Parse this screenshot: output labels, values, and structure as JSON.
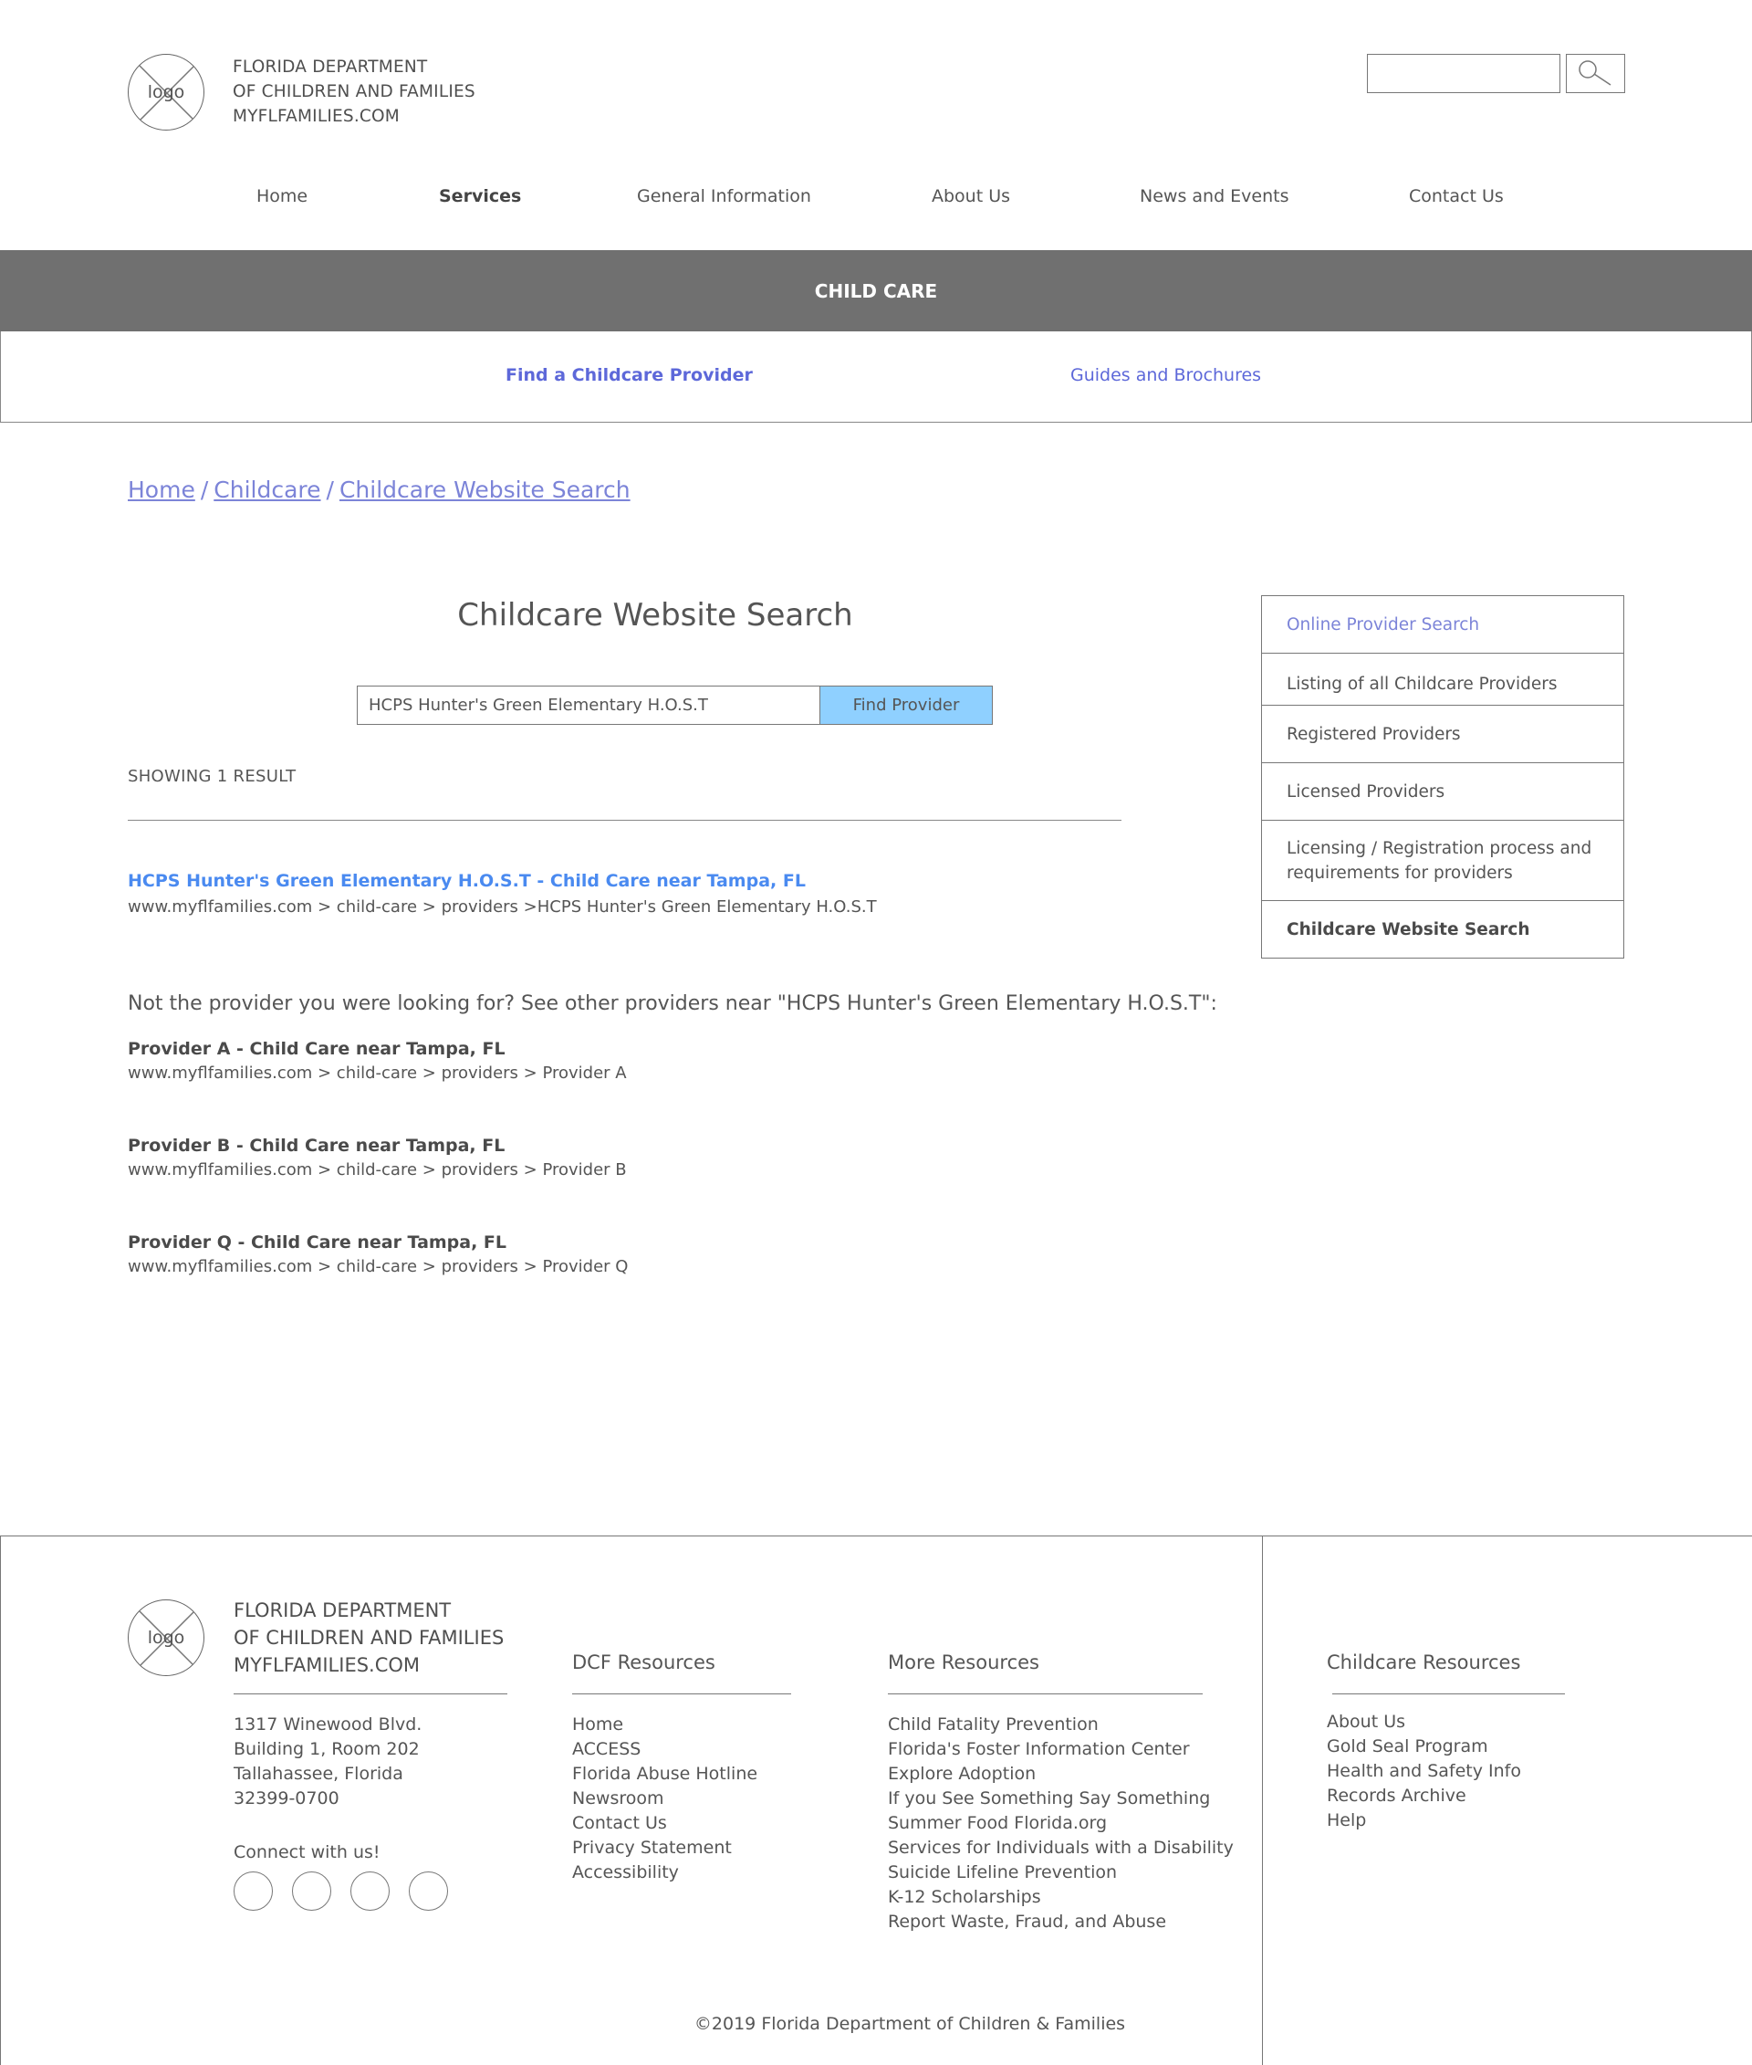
{
  "header": {
    "logo_label": "logo",
    "org_line1": "FLORIDA DEPARTMENT",
    "org_line2": "OF CHILDREN AND FAMILIES",
    "org_line3": "MYFLFAMILIES.COM",
    "search_value": "",
    "search_icon": "magnifier-icon"
  },
  "nav": {
    "items": [
      "Home",
      "Services",
      "General Information",
      "About Us",
      "News and Events",
      "Contact Us"
    ],
    "active": "Services"
  },
  "banner": {
    "title": "CHILD CARE"
  },
  "subnav": {
    "items": [
      "Find a Childcare Provider",
      "Guides and Brochures"
    ],
    "active": "Find a Childcare Provider",
    "link_color": "#5d68d9"
  },
  "breadcrumb": {
    "items": [
      "Home",
      "Childcare",
      "Childcare Website Search"
    ],
    "separator": "/"
  },
  "main": {
    "title": "Childcare Website Search",
    "search_query": "HCPS Hunter's Green Elementary H.O.S.T",
    "search_button": "Find Provider",
    "button_color": "#8fd0ff",
    "result_count": "SHOWING 1 RESULT",
    "result": {
      "title": "HCPS Hunter's Green Elementary H.O.S.T - Child Care near Tampa, FL",
      "url": "www.myflfamilies.com > child-care > providers >HCPS Hunter's Green Elementary H.O.S.T",
      "color": "#4a8af0"
    },
    "not_found_note": "Not the provider you were looking for? See other providers near \"HCPS Hunter's Green Elementary H.O.S.T\":",
    "nearby": [
      {
        "title": "Provider A - Child Care near Tampa, FL",
        "url": "www.myflfamilies.com > child-care > providers > Provider A"
      },
      {
        "title": "Provider B - Child Care near Tampa, FL",
        "url": "www.myflfamilies.com > child-care > providers > Provider B"
      },
      {
        "title": "Provider Q - Child Care near Tampa, FL",
        "url": "www.myflfamilies.com > child-care > providers > Provider Q"
      }
    ]
  },
  "sidebar": {
    "items": [
      "Online Provider Search",
      "Listing of all Childcare Providers",
      "Registered Providers",
      "Licensed Providers",
      "Licensing / Registration process and requirements for providers",
      "Childcare Website Search"
    ],
    "current": "Childcare Website Search"
  },
  "footer": {
    "logo_label": "logo",
    "org_line1": "FLORIDA DEPARTMENT",
    "org_line2": "OF CHILDREN AND FAMILIES",
    "org_line3": "MYFLFAMILIES.COM",
    "address": [
      "1317 Winewood Blvd.",
      "Building 1, Room 202",
      "Tallahassee, Florida",
      "32399-0700"
    ],
    "connect": "Connect with us!",
    "social_icons": [
      "social-icon-1",
      "social-icon-2",
      "social-icon-3",
      "social-icon-4"
    ],
    "dcf_heading": "DCF Resources",
    "dcf_links": [
      "Home",
      "ACCESS",
      "Florida Abuse Hotline",
      "Newsroom",
      "Contact Us",
      "Privacy Statement",
      "Accessibility"
    ],
    "more_heading": "More Resources",
    "more_links": [
      "Child Fatality Prevention",
      "Florida's Foster Information Center",
      "Explore Adoption",
      "If you See Something Say Something",
      "Summer Food Florida.org",
      "Services for Individuals with a Disability",
      "Suicide Lifeline Prevention",
      "K-12 Scholarships",
      "Report Waste, Fraud, and Abuse"
    ],
    "childcare_heading": "Childcare Resources",
    "childcare_links": [
      "About Us",
      "Gold Seal Program",
      "Health and Safety Info",
      "Records Archive",
      "Help"
    ],
    "copyright": "©2019 Florida Department of Children & Families"
  }
}
